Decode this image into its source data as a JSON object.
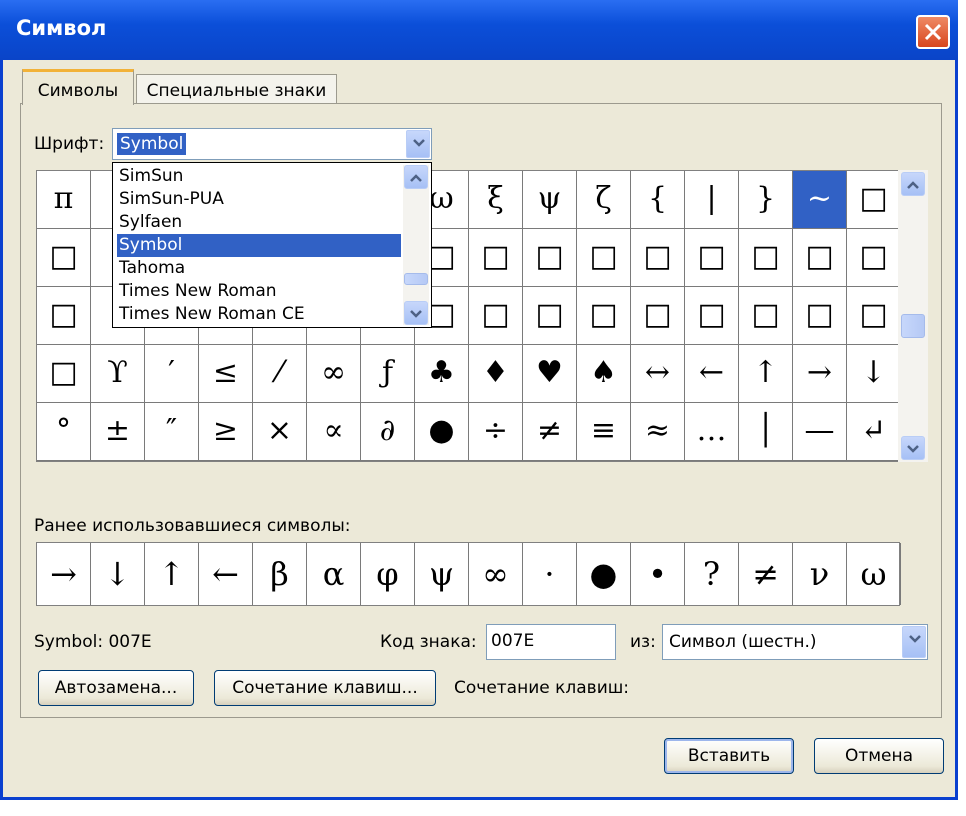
{
  "window": {
    "title": "Символ"
  },
  "tabs": [
    {
      "label": "Символы"
    },
    {
      "label": "Специальные знаки"
    }
  ],
  "font": {
    "label": "Шрифт:",
    "selected": "Symbol",
    "options": [
      "SimSun",
      "SimSun-PUA",
      "Sylfaen",
      "Symbol",
      "Tahoma",
      "Times New Roman",
      "Times New Roman CE"
    ],
    "highlighted_index": 3
  },
  "grid": {
    "rows": [
      [
        "π",
        "",
        "",
        "",
        "",
        "",
        "",
        "ω",
        "ξ",
        "ψ",
        "ζ",
        "{",
        "|",
        "}",
        "~",
        "□"
      ],
      [
        "□",
        "",
        "",
        "",
        "",
        "",
        "",
        "□",
        "□",
        "□",
        "□",
        "□",
        "□",
        "□",
        "□",
        "□"
      ],
      [
        "□",
        "",
        "",
        "",
        "",
        "",
        "",
        "□",
        "□",
        "□",
        "□",
        "□",
        "□",
        "□",
        "□",
        "□"
      ],
      [
        "□",
        "ϒ",
        "′",
        "≤",
        "⁄",
        "∞",
        "ƒ",
        "♣",
        "♦",
        "♥",
        "♠",
        "↔",
        "←",
        "↑",
        "→",
        "↓"
      ],
      [
        "°",
        "±",
        "″",
        "≥",
        "×",
        "∝",
        "∂",
        "●",
        "÷",
        "≠",
        "≡",
        "≈",
        "…",
        "│",
        "—",
        "↵"
      ]
    ],
    "selected": {
      "row": 0,
      "col": 14
    }
  },
  "recent": {
    "label": "Ранее использовавшиеся символы:",
    "symbols": [
      "→",
      "↓",
      "↑",
      "←",
      "β",
      "α",
      "φ",
      "ψ",
      "∞",
      "·",
      "●",
      "•",
      "?",
      "≠",
      "ν",
      "ω"
    ]
  },
  "info": {
    "symbol_name": "Symbol: 007E",
    "code_label": "Код знака:",
    "code_value": "007E",
    "from_label": "из:",
    "from_value": "Символ (шестн.)",
    "shortcut_label": "Сочетание клавиш:"
  },
  "buttons": {
    "autocorrect": "Автозамена...",
    "shortcut_key": "Сочетание клавиш...",
    "insert": "Вставить",
    "cancel": "Отмена"
  }
}
